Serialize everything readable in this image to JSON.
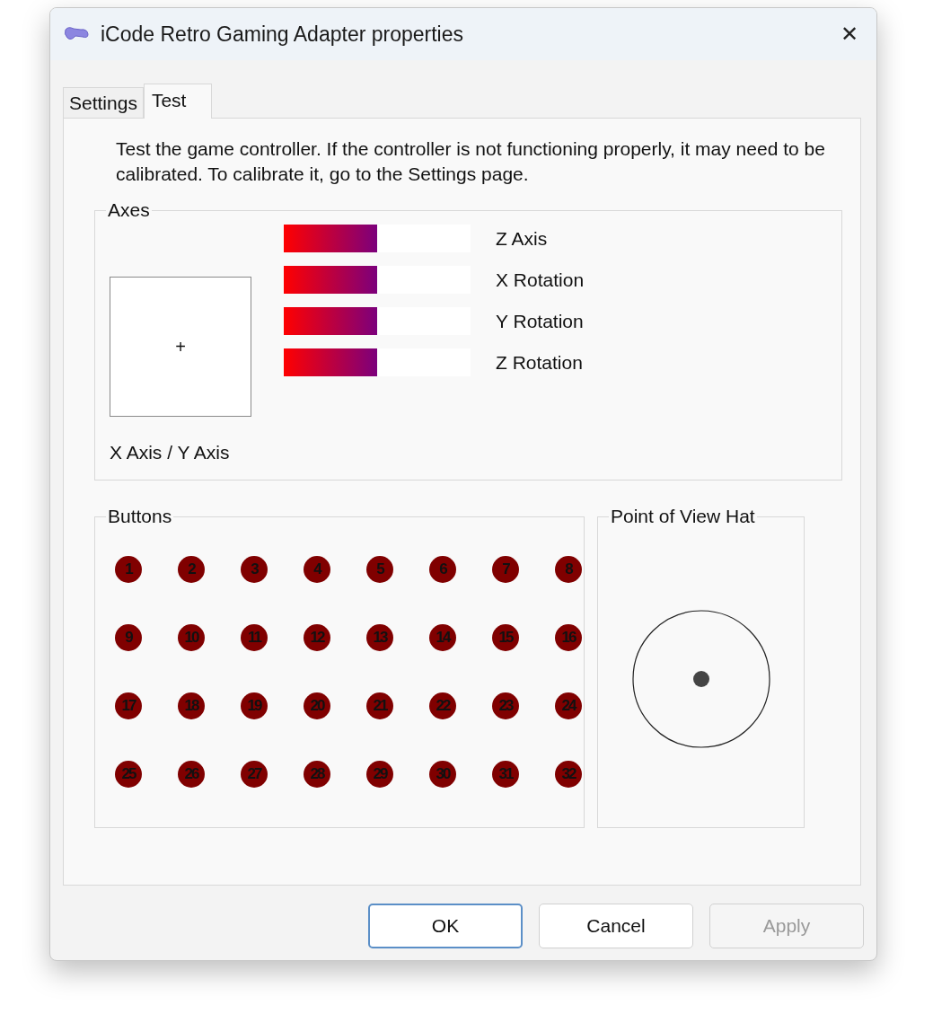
{
  "window": {
    "title": "iCode Retro Gaming Adapter properties",
    "close": "✕"
  },
  "tabs": [
    {
      "label": "Settings",
      "selected": false
    },
    {
      "label": "Test",
      "selected": true
    }
  ],
  "intro": "Test the game controller.  If the controller is not functioning properly, it may need to be calibrated.  To calibrate it, go to the Settings page.",
  "axes": {
    "title": "Axes",
    "xy_label": "X Axis / Y Axis",
    "cursor": "+",
    "bars": [
      {
        "name": "Z Axis",
        "level": 0.5
      },
      {
        "name": "X Rotation",
        "level": 0.5
      },
      {
        "name": "Y Rotation",
        "level": 0.5
      },
      {
        "name": "Z Rotation",
        "level": 0.5
      }
    ]
  },
  "buttons_group": {
    "title": "Buttons",
    "buttons": [
      {
        "label": "1",
        "pressed": false
      },
      {
        "label": "2",
        "pressed": false
      },
      {
        "label": "3",
        "pressed": false
      },
      {
        "label": "4",
        "pressed": false
      },
      {
        "label": "5",
        "pressed": false
      },
      {
        "label": "6",
        "pressed": false
      },
      {
        "label": "7",
        "pressed": false
      },
      {
        "label": "8",
        "pressed": false
      },
      {
        "label": "9",
        "pressed": false
      },
      {
        "label": "10",
        "pressed": false
      },
      {
        "label": "11",
        "pressed": false
      },
      {
        "label": "12",
        "pressed": false
      },
      {
        "label": "13",
        "pressed": false
      },
      {
        "label": "14",
        "pressed": false
      },
      {
        "label": "15",
        "pressed": false
      },
      {
        "label": "16",
        "pressed": false
      },
      {
        "label": "17",
        "pressed": false
      },
      {
        "label": "18",
        "pressed": false
      },
      {
        "label": "19",
        "pressed": false
      },
      {
        "label": "20",
        "pressed": false
      },
      {
        "label": "21",
        "pressed": false
      },
      {
        "label": "22",
        "pressed": false
      },
      {
        "label": "23",
        "pressed": false
      },
      {
        "label": "24",
        "pressed": false
      },
      {
        "label": "25",
        "pressed": false
      },
      {
        "label": "26",
        "pressed": false
      },
      {
        "label": "27",
        "pressed": false
      },
      {
        "label": "28",
        "pressed": false
      },
      {
        "label": "29",
        "pressed": false
      },
      {
        "label": "30",
        "pressed": false
      },
      {
        "label": "31",
        "pressed": false
      },
      {
        "label": "32",
        "pressed": false
      }
    ]
  },
  "pov": {
    "title": "Point of View Hat"
  },
  "footer": [
    {
      "label": "OK",
      "kind": "default",
      "disabled": false
    },
    {
      "label": "Cancel",
      "kind": "normal",
      "disabled": false
    },
    {
      "label": "Apply",
      "kind": "normal",
      "disabled": true
    }
  ]
}
